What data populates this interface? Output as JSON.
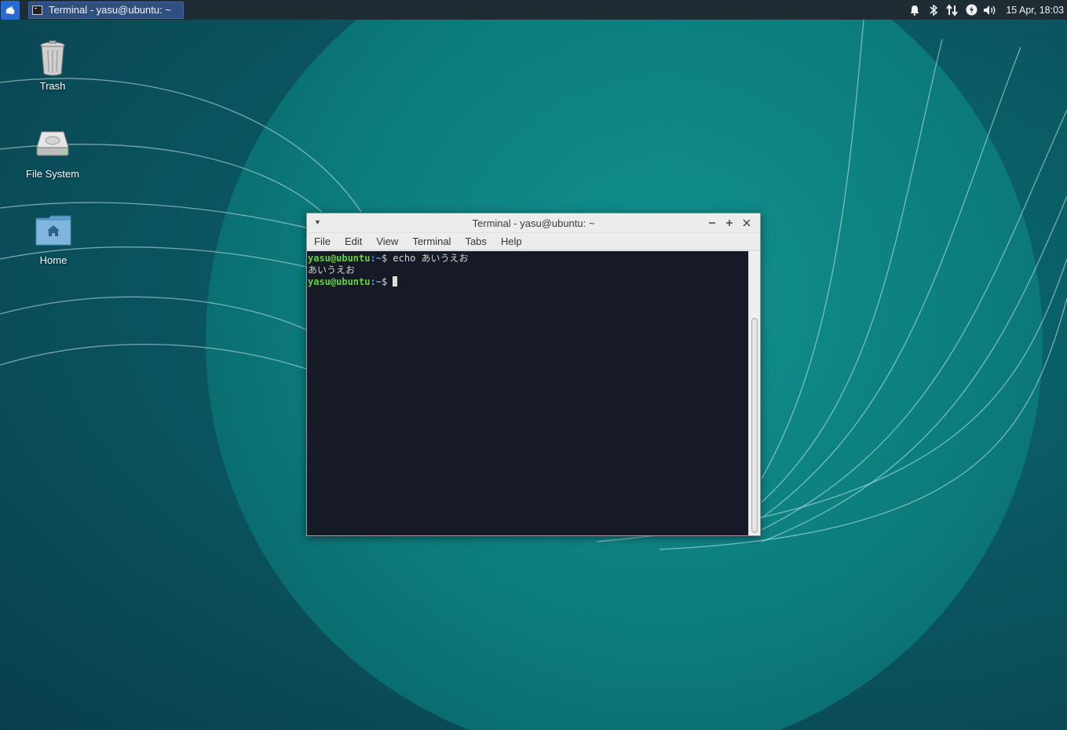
{
  "panel": {
    "app_menu_icon": "xfce-mouse-icon",
    "task_title": "Terminal - yasu@ubuntu: ~",
    "tray_icons": [
      "bell-icon",
      "bluetooth-icon",
      "network-icon",
      "power-icon",
      "volume-icon"
    ],
    "clock": "15 Apr, 18:03"
  },
  "desktop": {
    "icons": [
      {
        "label": "Trash"
      },
      {
        "label": "File System"
      },
      {
        "label": "Home"
      }
    ]
  },
  "window": {
    "title": "Terminal - yasu@ubuntu: ~",
    "menu": [
      "File",
      "Edit",
      "View",
      "Terminal",
      "Tabs",
      "Help"
    ],
    "terminal": {
      "lines": [
        {
          "user": "yasu@ubuntu",
          "path": ":~",
          "prompt": "$ ",
          "cmd": "echo あいうえお"
        },
        {
          "output": "あいうえお"
        },
        {
          "user": "yasu@ubuntu",
          "path": ":~",
          "prompt": "$ ",
          "cmd": ""
        }
      ]
    }
  },
  "colors": {
    "panel_bg": "#1e2d34",
    "task_bg": "#2e4f7f",
    "terminal_bg": "#151a26",
    "prompt_user": "#5fd73c",
    "prompt_path": "#6a9ee8",
    "desktop_teal": "#0a6e72"
  }
}
